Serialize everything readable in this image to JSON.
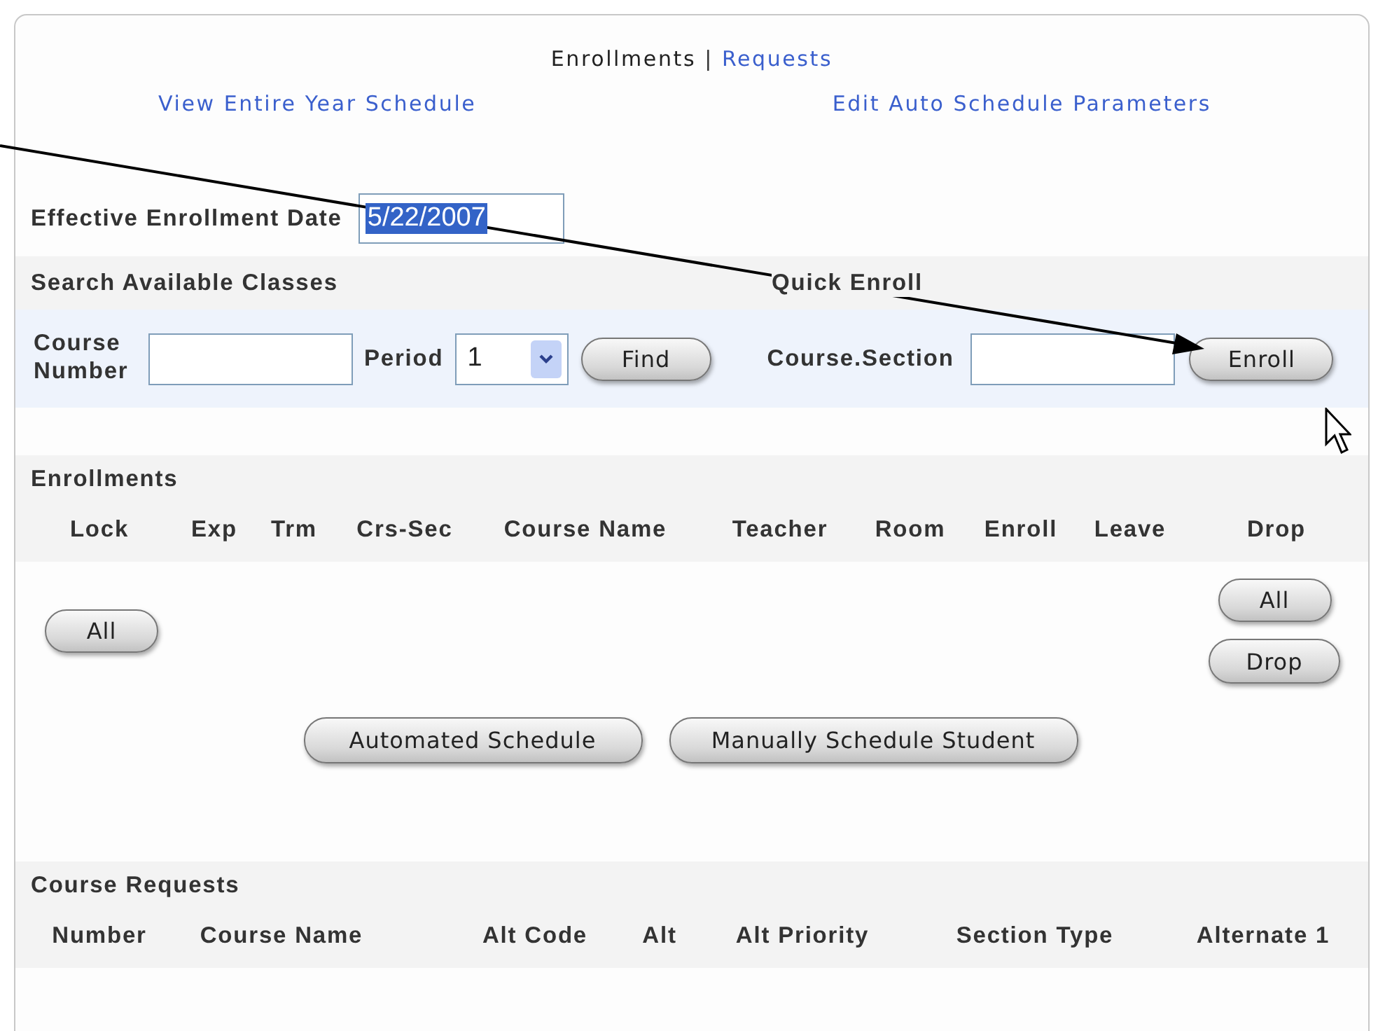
{
  "nav": {
    "items": [
      {
        "label": "Enrollments",
        "selected": true
      },
      {
        "label": "Requests",
        "selected": false
      }
    ],
    "separator": "|"
  },
  "links": [
    "View Entire Year Schedule",
    "Edit Auto Schedule Parameters"
  ],
  "effective_date": {
    "label": "Effective Enrollment Date",
    "value": "5/22/2007",
    "value_selected": true
  },
  "search": {
    "title": "Search Available Classes",
    "course_label": "Course Number",
    "period_label": "Period",
    "period_value": "1",
    "find_button": "Find"
  },
  "quick_enroll": {
    "title": "Quick Enroll",
    "section_label": "Course.Section",
    "enroll_button": "Enroll"
  },
  "enrollments": {
    "title": "Enrollments",
    "columns": [
      "Lock",
      "Exp",
      "Trm",
      "Crs-Sec",
      "Course Name",
      "Teacher",
      "Room",
      "Enroll",
      "Leave",
      "Drop"
    ],
    "lock_all_button": "All",
    "drop_all_button": "All",
    "drop_button": "Drop",
    "actions": [
      "Automated Schedule",
      "Manually Schedule Student"
    ]
  },
  "course_requests": {
    "title": "Course Requests",
    "columns": [
      "Number",
      "Course Name",
      "Alt Code",
      "Alt",
      "Alt Priority",
      "Section Type",
      "Alternate 1"
    ]
  }
}
